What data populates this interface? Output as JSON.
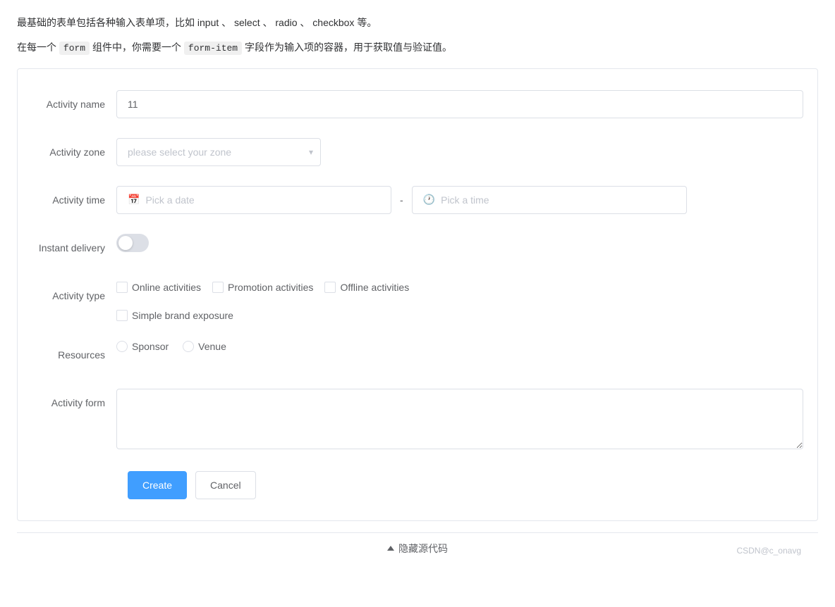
{
  "intro": {
    "line1": "最基础的表单包括各种输入表单项，比如 input 、 select 、 radio 、 checkbox 等。",
    "line2_prefix": "在每一个",
    "line2_form": "form",
    "line2_mid": "组件中，你需要一个",
    "line2_form_item": "form-item",
    "line2_suffix": "字段作为输入项的容器，用于获取值与验证值。"
  },
  "form": {
    "fields": {
      "activity_name": {
        "label": "Activity name",
        "value": "11",
        "placeholder": ""
      },
      "activity_zone": {
        "label": "Activity zone",
        "placeholder": "please select your zone"
      },
      "activity_time": {
        "label": "Activity time",
        "date_placeholder": "Pick a date",
        "separator": "-",
        "time_placeholder": "Pick a time"
      },
      "instant_delivery": {
        "label": "Instant delivery"
      },
      "activity_type": {
        "label": "Activity type",
        "options": [
          "Online activities",
          "Promotion activities",
          "Offline activities",
          "Simple brand exposure"
        ]
      },
      "resources": {
        "label": "Resources",
        "options": [
          "Sponsor",
          "Venue"
        ]
      },
      "activity_form": {
        "label": "Activity form",
        "placeholder": ""
      }
    },
    "buttons": {
      "create": "Create",
      "cancel": "Cancel"
    }
  },
  "bottom": {
    "hide_code": "隐藏源代码",
    "watermark": "CSDN@c_onavg"
  }
}
